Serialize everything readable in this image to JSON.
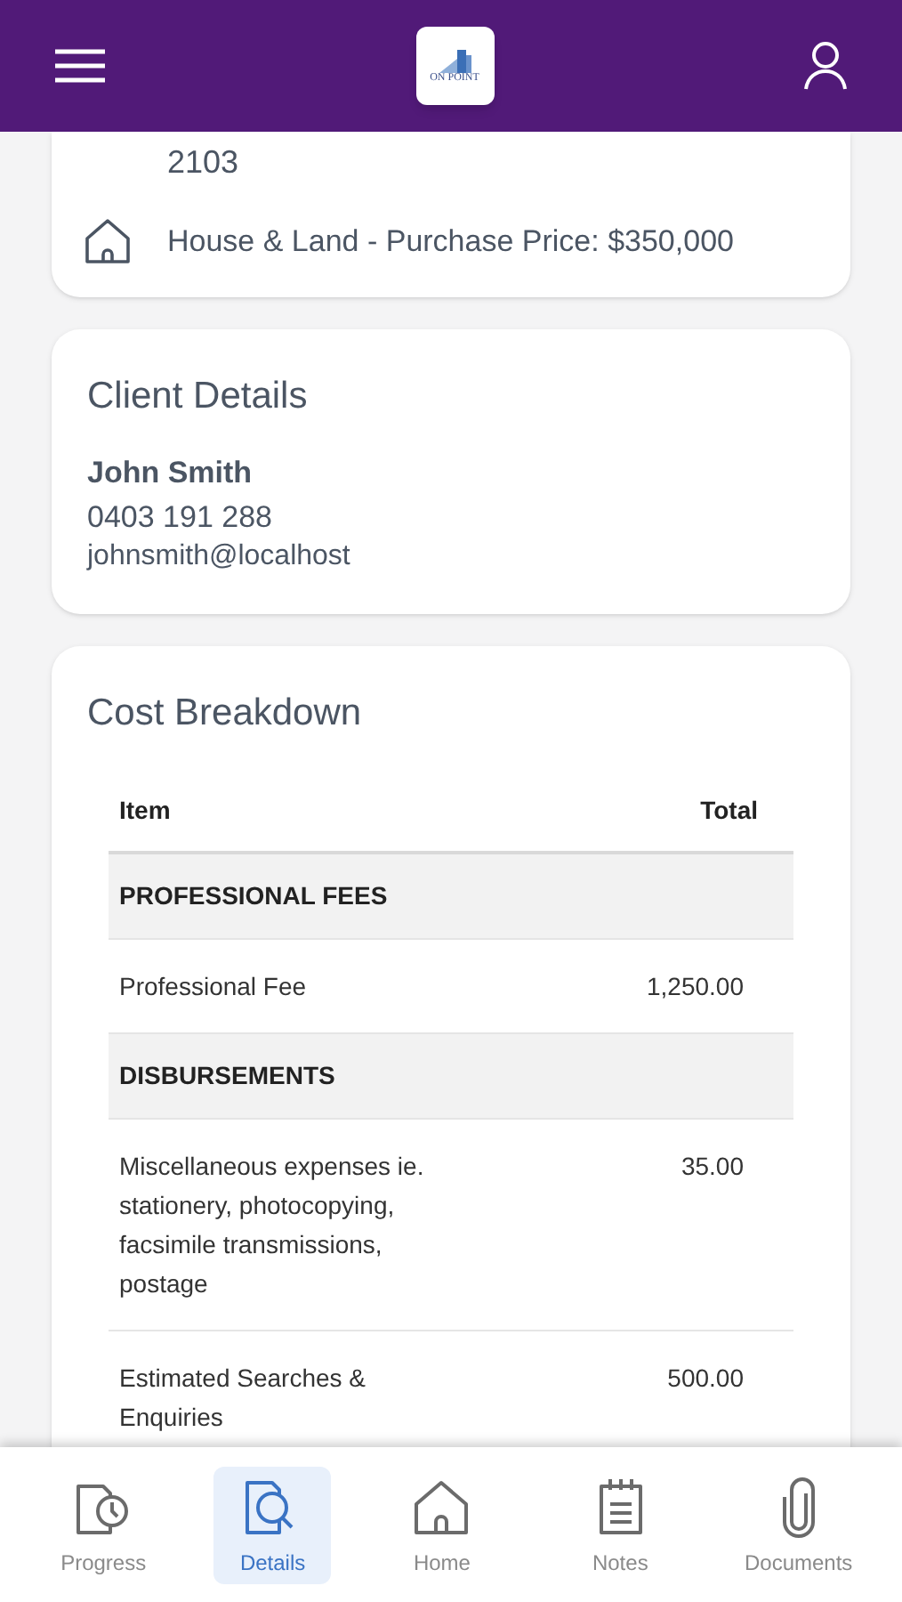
{
  "header": {
    "logo_text": "ON POINT"
  },
  "property": {
    "postcode": "2103",
    "description": "House & Land - Purchase Price: $350,000"
  },
  "client": {
    "title": "Client Details",
    "name": "John Smith",
    "phone": "0403 191 288",
    "email": "johnsmith@localhost"
  },
  "costs": {
    "title": "Cost Breakdown",
    "columns": [
      "Item",
      "Total"
    ],
    "rows": [
      {
        "kind": "group",
        "item": "PROFESSIONAL FEES"
      },
      {
        "kind": "line",
        "item": "Professional Fee",
        "total": "1,250.00"
      },
      {
        "kind": "group",
        "item": "DISBURSEMENTS"
      },
      {
        "kind": "line",
        "item": "Miscellaneous expenses ie. stationery, photocopying, facsimile transmissions, postage",
        "total": "35.00"
      },
      {
        "kind": "line",
        "item": "Estimated Searches & Enquiries",
        "total": "500.00"
      }
    ]
  },
  "nav": [
    {
      "kind": "progress",
      "label": "Progress",
      "selected": false
    },
    {
      "kind": "details",
      "label": "Details",
      "selected": true
    },
    {
      "kind": "home",
      "label": "Home",
      "selected": false
    },
    {
      "kind": "notes",
      "label": "Notes",
      "selected": false
    },
    {
      "kind": "documents",
      "label": "Documents",
      "selected": false
    }
  ]
}
